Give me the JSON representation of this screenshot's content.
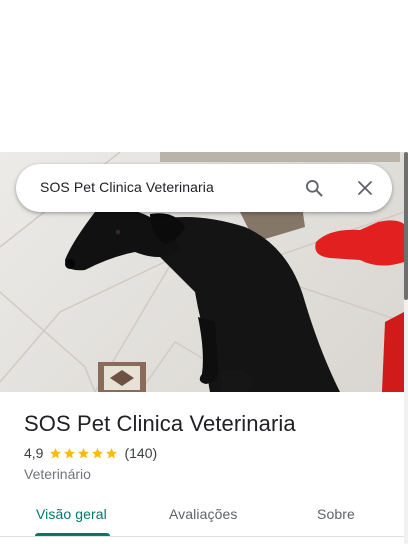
{
  "search": {
    "query": "SOS Pet Clinica Veterinaria",
    "search_icon": "search-icon",
    "close_icon": "close-icon"
  },
  "place": {
    "name": "SOS Pet Clinica Veterinaria",
    "rating": "4,9",
    "stars": 5,
    "review_count": "(140)",
    "category": "Veterinário"
  },
  "tabs": [
    {
      "label": "Visão geral",
      "active": true
    },
    {
      "label": "Avaliações",
      "active": false
    },
    {
      "label": "Sobre",
      "active": false
    }
  ],
  "colors": {
    "accent": "#00796b",
    "star": "#fbbc04",
    "text_primary": "#202124",
    "text_secondary": "#70757a"
  }
}
